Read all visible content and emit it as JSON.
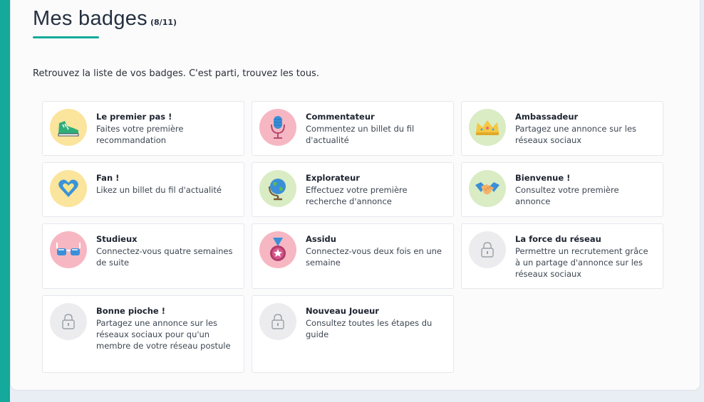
{
  "header": {
    "title": "Mes badges",
    "count": "(8/11)"
  },
  "intro": "Retrouvez la liste de vos badges. C'est parti, trouvez les tous.",
  "colors": {
    "accent": "#14a99a",
    "yellow": "#fbe49b",
    "pink": "#f6b7c2",
    "green": "#d9ecc4",
    "locked": "#ececee"
  },
  "badges": [
    {
      "title": "Le premier pas !",
      "desc": "Faites votre première recommandation",
      "icon": "sneaker-icon",
      "unlocked": true
    },
    {
      "title": "Commentateur",
      "desc": "Commentez un billet du fil d'actualité",
      "icon": "microphone-icon",
      "unlocked": true
    },
    {
      "title": "Ambassadeur",
      "desc": "Partagez une annonce sur les réseaux sociaux",
      "icon": "crown-icon",
      "unlocked": true
    },
    {
      "title": "Fan !",
      "desc": "Likez un billet du fil d'actualité",
      "icon": "heart-icon",
      "unlocked": true
    },
    {
      "title": "Explorateur",
      "desc": "Effectuez votre première recherche d'annonce",
      "icon": "globe-icon",
      "unlocked": true
    },
    {
      "title": "Bienvenue !",
      "desc": "Consultez votre première annonce",
      "icon": "handshake-icon",
      "unlocked": true
    },
    {
      "title": "Studieux",
      "desc": "Connectez-vous quatre semaines de suite",
      "icon": "glasses-icon",
      "unlocked": true
    },
    {
      "title": "Assidu",
      "desc": "Connectez-vous deux fois en une semaine",
      "icon": "medal-icon",
      "unlocked": true
    },
    {
      "title": "La force du réseau",
      "desc": "Permettre un recrutement grâce à un partage d'annonce sur les réseaux sociaux",
      "icon": "lock-icon",
      "unlocked": false
    },
    {
      "title": "Bonne pioche !",
      "desc": "Partagez une annonce sur les réseaux sociaux pour qu'un membre de votre réseau postule",
      "icon": "lock-icon",
      "unlocked": false
    },
    {
      "title": "Nouveau Joueur",
      "desc": "Consultez toutes les étapes du guide",
      "icon": "lock-icon",
      "unlocked": false
    }
  ]
}
